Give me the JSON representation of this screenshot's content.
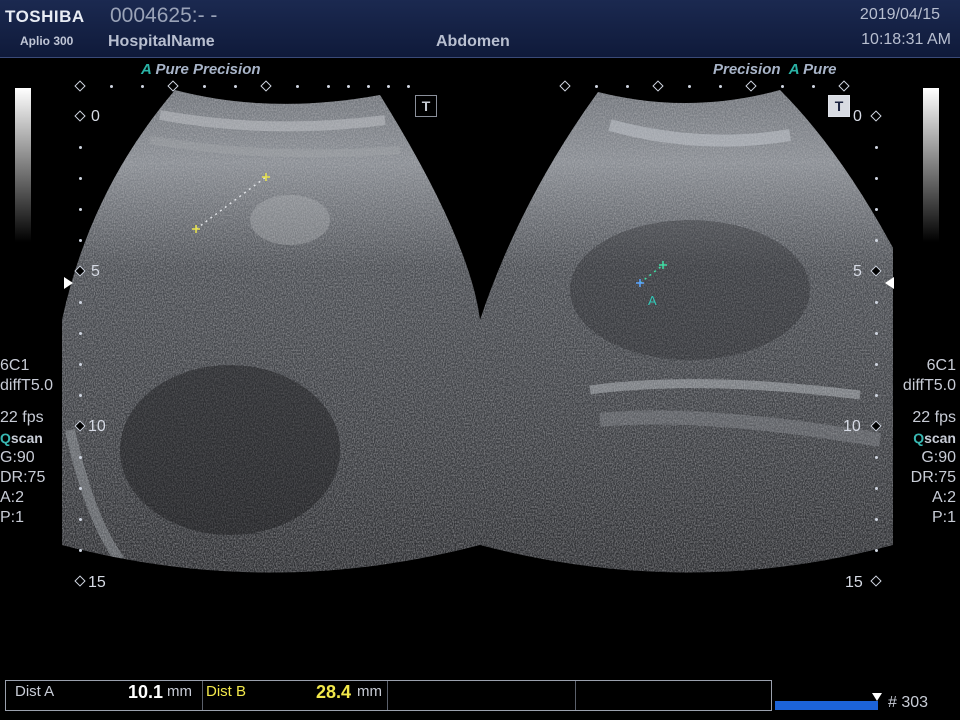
{
  "header": {
    "brand": "TOSHIBA",
    "model": "Aplio 300",
    "patient_id": "0004625:- -",
    "hospital": "HospitalName",
    "exam": "Abdomen",
    "date": "2019/04/15",
    "time": "10:18:31 AM"
  },
  "left_mode": {
    "a": "A",
    "pure": "Pure",
    "precision": "Precision"
  },
  "right_mode": {
    "precision": "Precision",
    "a": "A",
    "pure": "Pure"
  },
  "t_label": "T",
  "depth_scale": [
    "0",
    "5",
    "10",
    "15"
  ],
  "left_params": {
    "probe": "6C1",
    "preset": "diffT5.0",
    "fps": "22 fps",
    "q": "Q",
    "scan": "scan",
    "gain": "G:90",
    "dr": "DR:75",
    "a": "A:2",
    "p": "P:1"
  },
  "right_params": {
    "probe": "6C1",
    "preset": "diffT5.0",
    "fps": "22 fps",
    "q": "Q",
    "scan": "scan",
    "gain": "G:90",
    "dr": "DR:75",
    "a": "A:2",
    "p": "P:1"
  },
  "caliper_label": "A",
  "measurements": {
    "dist_a_label": "Dist A",
    "dist_a_value": "10.1",
    "dist_a_unit": "mm",
    "dist_b_label": "Dist B",
    "dist_b_value": "28.4",
    "dist_b_unit": "mm"
  },
  "cine": {
    "frame": "# 303"
  },
  "colors": {
    "header_bg": "#1b2950",
    "accent_teal": "#2ab3a6",
    "dist_b_color": "#f2e84a",
    "caliper_yellow": "#e9e44c",
    "caliper_green": "#3fe0a5",
    "progress_blue": "#1c63d8"
  }
}
